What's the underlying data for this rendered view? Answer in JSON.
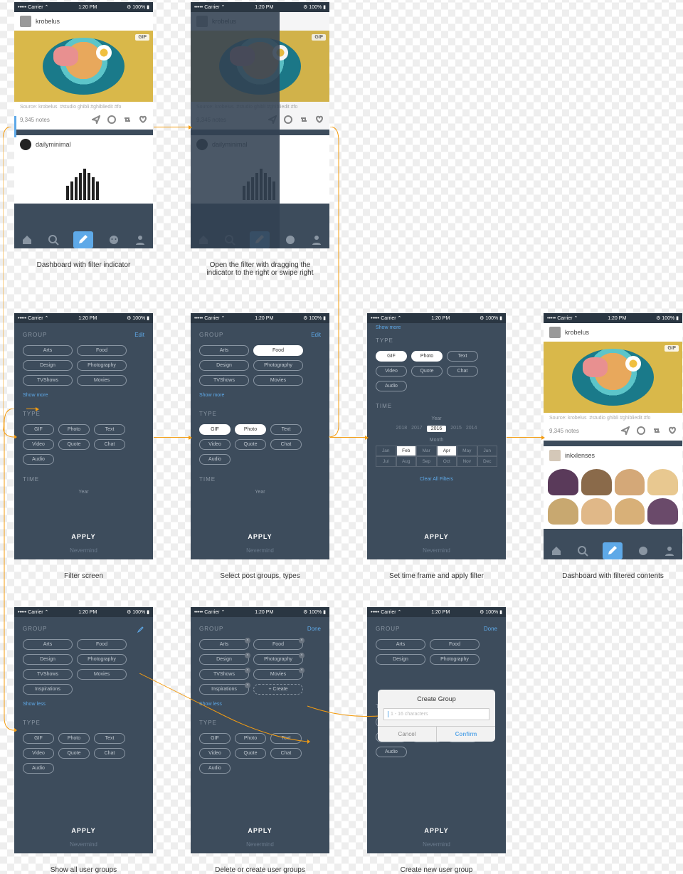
{
  "statusbar": {
    "carrier": "••••• Carrier ⌃",
    "time": "1:20 PM",
    "battery": "⚙ 100% ▮"
  },
  "captions": {
    "s1": "Dashboard with filter indicator",
    "s2": "Open the filter with dragging the\nindicator to the right or swipe right",
    "s3": "Filter screen",
    "s4": "Select post groups, types",
    "s5": "Set time frame and apply filter",
    "s6": "Dashboard with filtered contents",
    "s7": "Show all user groups",
    "s8": "Delete or create user groups",
    "s9": "Create new user group"
  },
  "post": {
    "user1": "krobelus",
    "user2": "dailyminimal",
    "user3": "inkxlenses",
    "gif": "GIF",
    "source": "Source: krobelus",
    "tags": "#studio ghibli   #ghibliedit   #fo",
    "notes": "9,345 notes"
  },
  "filter": {
    "group_h": "GROUP",
    "type_h": "TYPE",
    "time_h": "TIME",
    "edit": "Edit",
    "done": "Done",
    "showmore": "Show more",
    "showless": "Show less",
    "groups": [
      "Arts",
      "Food",
      "Design",
      "Photography",
      "TVShows",
      "Movies"
    ],
    "groups_ext": [
      "Arts",
      "Food",
      "Design",
      "Photography",
      "TVShows",
      "Movies",
      "Inspirations"
    ],
    "create": "+ Create",
    "types": [
      "GIF",
      "Photo",
      "Text",
      "Video",
      "Quote",
      "Chat",
      "Audio"
    ],
    "year_label": "Year",
    "years": [
      "2018",
      "2017",
      "2016",
      "2015",
      "2014"
    ],
    "year_selected": "2016",
    "month_label": "Month",
    "months": [
      "Jan",
      "Feb",
      "Mar",
      "Apr",
      "May",
      "Jun",
      "Jul",
      "Aug",
      "Sep",
      "Oct",
      "Nov",
      "Dec"
    ],
    "months_sel": [
      "Feb",
      "Apr"
    ],
    "clear": "Clear All Filters",
    "apply": "APPLY",
    "nevermind": "Nevermind"
  },
  "modal": {
    "title": "Create Group",
    "placeholder": "1 - 16 characters",
    "cancel": "Cancel",
    "confirm": "Confirm"
  }
}
